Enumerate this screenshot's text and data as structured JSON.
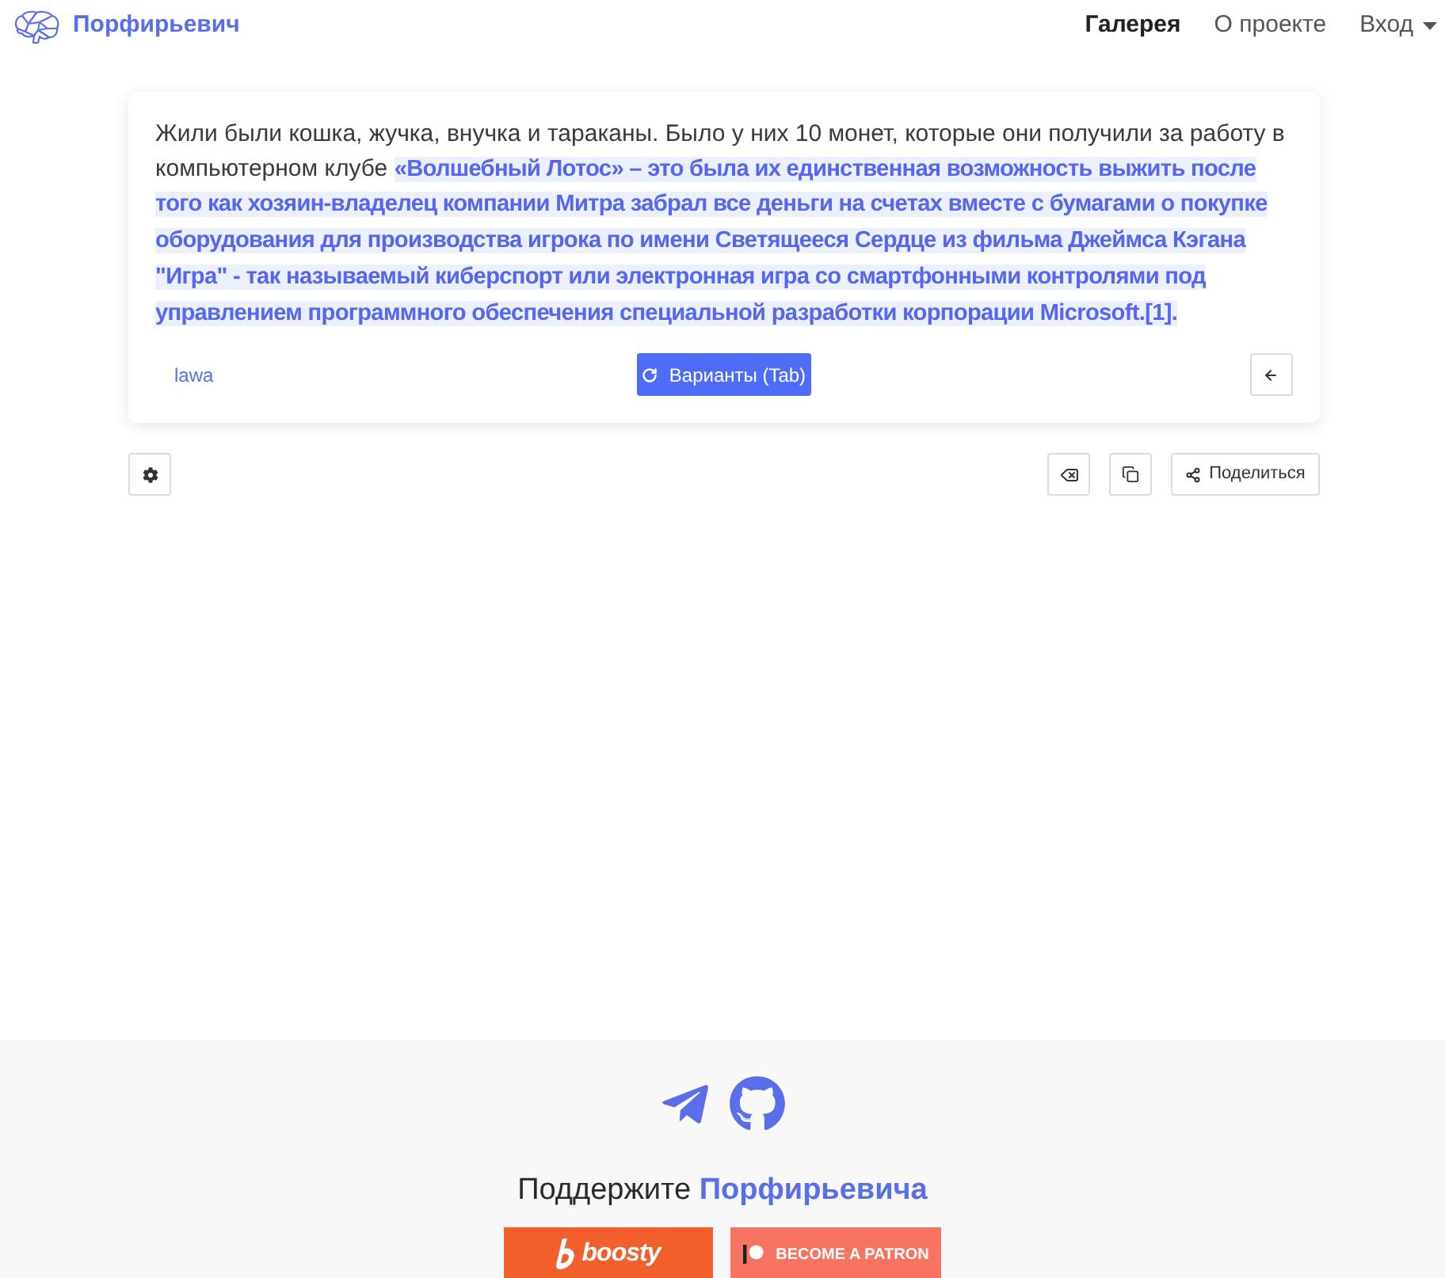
{
  "header": {
    "brand": "Порфирьевич",
    "nav": [
      {
        "label": "Галерея",
        "kind": "link",
        "selected": true
      },
      {
        "label": "О проекте",
        "kind": "link",
        "selected": false
      },
      {
        "label": "Вход",
        "kind": "dropdown",
        "selected": false
      }
    ]
  },
  "story": {
    "text": "Жили были кошка, жучка, внучка и тараканы. Было у них 10 монет, которые они получили за работу в компьютерном клубе **«Волшебный Лотос» – это была их единственная возможность выжить после того как хозяин-владелец компании Митра забрал все деньги на счетах вместе с бумагами о покупке оборудования для производства игрока по имени Светящееся Сердце из фильма Джеймса Кэгана \"Игра\" - так называемый киберспорт или электронная игра со смартфонными контролями под управлением программного обеспечения специальной разработки корпорации Microsoft.[1].**",
    "author": "lawa",
    "variants_button": "Варианты (Tab)"
  },
  "toolbar": {
    "share_button": "Поделиться"
  },
  "footer": {
    "support_title": "Поддержите **Порфирьевича**",
    "donate_buttons": [
      {
        "kind": "boosty",
        "label": "boosty"
      },
      {
        "kind": "patreon",
        "label": "BECOME A PATRON"
      }
    ]
  }
}
